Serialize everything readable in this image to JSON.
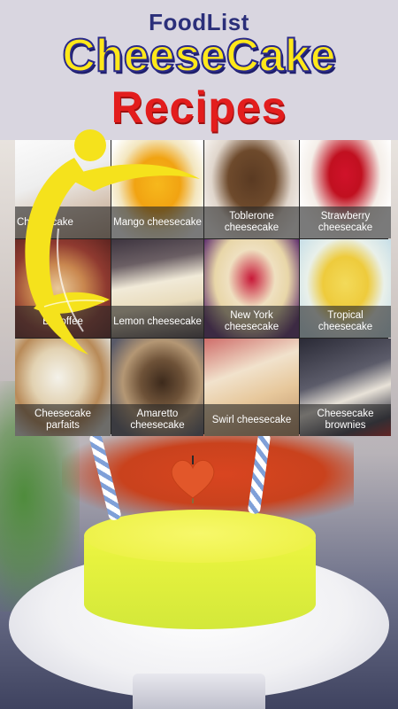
{
  "header": {
    "brand": "FoodList",
    "title_line1": "CheeseCake",
    "title_line2": "Recipes"
  },
  "recipes": [
    {
      "label": "Cheesecake"
    },
    {
      "label": "Mango cheesecake"
    },
    {
      "label": "Toblerone cheesecake"
    },
    {
      "label": "Strawberry cheesecake"
    },
    {
      "label": "Banoffee"
    },
    {
      "label": "Lemon cheesecake"
    },
    {
      "label": "New York cheesecake"
    },
    {
      "label": "Tropical cheesecake"
    },
    {
      "label": "Cheesecake parfaits"
    },
    {
      "label": "Amaretto cheesecake"
    },
    {
      "label": "Swirl cheesecake"
    },
    {
      "label": "Cheesecake brownies"
    }
  ],
  "colors": {
    "brand_text": "#2b2f7a",
    "title_yellow": "#ffe81a",
    "title_red": "#e31d1d",
    "logo_yellow": "#f5e21c"
  },
  "icons": {
    "logo": "foodlist-swirl-logo",
    "heart_candle": "heart-candle-icon"
  }
}
